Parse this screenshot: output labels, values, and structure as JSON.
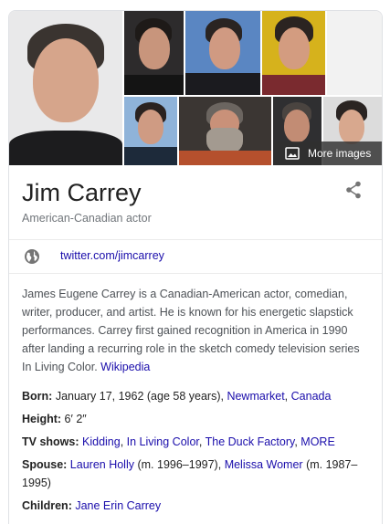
{
  "entity": {
    "name": "Jim Carrey",
    "subtitle": "American-Canadian actor"
  },
  "gallery": {
    "more_images_label": "More images"
  },
  "social": {
    "link_text": "twitter.com/jimcarrey"
  },
  "description": {
    "text": "James Eugene Carrey is a Canadian-American actor, comedian, writer, producer, and artist. He is known for his energetic slapstick performances. Carrey first gained recognition in America in 1990 after landing a recurring role in the sketch comedy television series In Living Color.",
    "source_link": "Wikipedia"
  },
  "facts": {
    "born": {
      "label": "Born:",
      "value": "January 17, 1962 (age 58 years),",
      "link1": "Newmarket",
      "sep": ",",
      "link2": "Canada"
    },
    "height": {
      "label": "Height:",
      "value": "6′ 2″"
    },
    "tv_shows": {
      "label": "TV shows:",
      "items": [
        "Kidding",
        "In Living Color",
        "The Duck Factory",
        "MORE"
      ]
    },
    "spouse": {
      "label": "Spouse:",
      "link1": "Lauren Holly",
      "value1": "(m. 1996–1997),",
      "link2": "Melissa Womer",
      "value2": "(m. 1987–1995)"
    },
    "children": {
      "label": "Children:",
      "link": "Jane Erin Carrey"
    }
  },
  "colors": {
    "link": "#1a0dab",
    "text": "#222222",
    "secondary": "#70757a",
    "border": "#dfe1e5"
  }
}
